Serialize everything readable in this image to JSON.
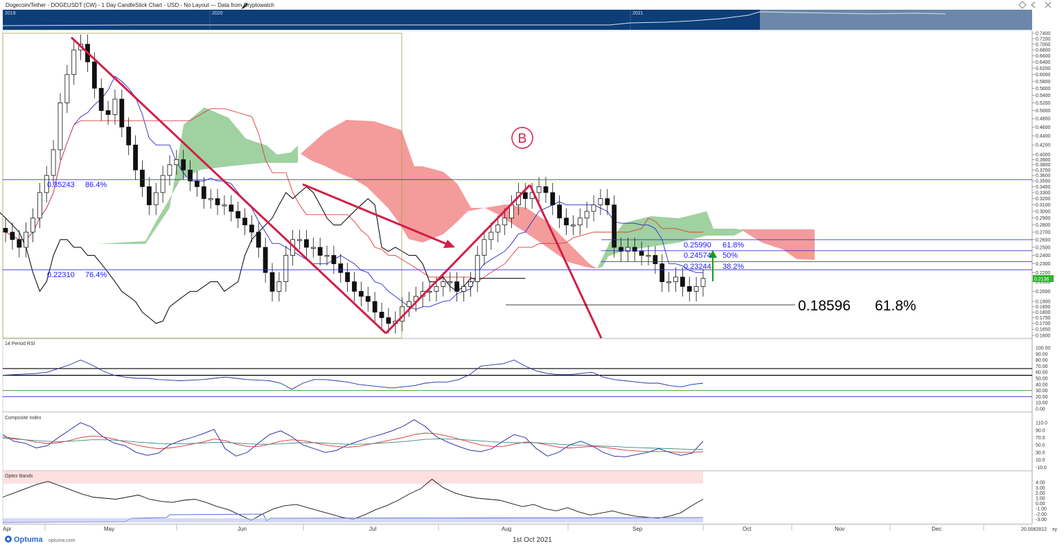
{
  "header": {
    "title": "Dogecoin/Tether - DOGEUSDT (CW) - 1 Day CandleStick Chart - USD - No Layout --- Data from Cryptowatch",
    "icons": [
      "pencil-icon",
      "diamond-icon",
      "chevron-left-icon",
      "close-icon"
    ]
  },
  "navigator": {
    "year_labels": [
      "2019",
      "2020",
      "2021"
    ]
  },
  "footer": {
    "brand": "Optuma",
    "brand_url_text": "optuma.com",
    "date_label": "1st Oct 2021",
    "scale_readout": "20.0082812",
    "xy_label": "xy"
  },
  "annotations": {
    "wave_label": "B",
    "last_price_tag": "0.2136",
    "fib_levels": [
      {
        "value": "0.35243",
        "pct": "86.4%",
        "price": 0.35243
      },
      {
        "value": "0.22310",
        "pct": "76.4%",
        "price": 0.2231
      },
      {
        "value": "0.25990",
        "pct": "61.8%",
        "price": 0.2599
      },
      {
        "value": "0.24574",
        "pct": "50%",
        "price": 0.24574
      },
      {
        "value": "0.23244",
        "pct": "38.2%",
        "price": 0.23244
      }
    ],
    "big_fib": {
      "value": "0.18596",
      "pct": "61.8%",
      "price": 0.18596
    }
  },
  "chart_data": [
    {
      "type": "candlestick",
      "title": "",
      "price_axis": {
        "scale": "log",
        "ticks": [
          "0.7400",
          "0.7200",
          "0.7000",
          "0.6800",
          "0.6600",
          "0.6400",
          "0.6200",
          "0.6000",
          "0.5800",
          "0.5600",
          "0.5400",
          "0.5200",
          "0.5000",
          "0.4800",
          "0.4600",
          "0.4400",
          "0.4200",
          "0.4000",
          "0.3900",
          "0.3800",
          "0.3700",
          "0.3600",
          "0.3500",
          "0.3400",
          "0.3300",
          "0.3200",
          "0.3100",
          "0.3000",
          "0.2900",
          "0.2800",
          "0.2700",
          "0.2600",
          "0.2500",
          "0.2400",
          "0.2300",
          "0.2200",
          "0.2100",
          "0.2000",
          "0.1900",
          "0.1850",
          "0.1800",
          "0.1750",
          "0.1700",
          "0.1650",
          "0.1600"
        ],
        "range": [
          0.155,
          0.75
        ]
      },
      "x_axis_labels": [
        "Apr",
        "May",
        "Jun",
        "Jul",
        "Aug",
        "Sep",
        "Oct",
        "Nov",
        "Dec"
      ],
      "x_label": "1st Oct 2021",
      "series": [
        {
          "name": "DOGEUSDT",
          "kind": "ohlc",
          "close_path": [
            0.27,
            0.26,
            0.25,
            0.27,
            0.29,
            0.33,
            0.36,
            0.41,
            0.52,
            0.6,
            0.68,
            0.7,
            0.64,
            0.56,
            0.5,
            0.49,
            0.53,
            0.46,
            0.42,
            0.37,
            0.34,
            0.31,
            0.33,
            0.36,
            0.38,
            0.39,
            0.37,
            0.35,
            0.34,
            0.32,
            0.32,
            0.31,
            0.31,
            0.3,
            0.29,
            0.28,
            0.27,
            0.25,
            0.22,
            0.2,
            0.21,
            0.24,
            0.26,
            0.26,
            0.25,
            0.25,
            0.24,
            0.24,
            0.23,
            0.22,
            0.21,
            0.2,
            0.195,
            0.19,
            0.18,
            0.175,
            0.17,
            0.172,
            0.185,
            0.19,
            0.195,
            0.2,
            0.2,
            0.205,
            0.21,
            0.21,
            0.2,
            0.205,
            0.21,
            0.24,
            0.26,
            0.27,
            0.28,
            0.29,
            0.31,
            0.33,
            0.32,
            0.33,
            0.34,
            0.33,
            0.31,
            0.29,
            0.28,
            0.28,
            0.29,
            0.3,
            0.31,
            0.32,
            0.31,
            0.25,
            0.245,
            0.25,
            0.245,
            0.24,
            0.24,
            0.23,
            0.21,
            0.21,
            0.215,
            0.205,
            0.2,
            0.205,
            0.2136
          ]
        },
        {
          "name": "",
          "kind": "line",
          "color": "#0000cc"
        },
        {
          "name": "",
          "kind": "line",
          "color": "#e03030"
        },
        {
          "name": "",
          "kind": "line",
          "color": "#000000"
        }
      ]
    },
    {
      "type": "line",
      "title": "14 Period RSI",
      "ticks": [
        "100.00",
        "90.00",
        "80.00",
        "70.00",
        "60.00",
        "50.00",
        "40.00",
        "30.00",
        "20.00",
        "10.00",
        "0.00"
      ],
      "ylim": [
        0,
        100
      ],
      "levels": [
        66,
        55,
        30,
        20
      ],
      "values": [
        55,
        56,
        57,
        58,
        60,
        66,
        72,
        80,
        72,
        62,
        55,
        52,
        50,
        50,
        48,
        47,
        46,
        47,
        48,
        50,
        52,
        50,
        48,
        47,
        46,
        42,
        32,
        42,
        48,
        48,
        46,
        44,
        40,
        38,
        36,
        34,
        36,
        38,
        42,
        44,
        44,
        48,
        56,
        70,
        72,
        74,
        80,
        70,
        62,
        58,
        56,
        56,
        58,
        60,
        52,
        48,
        46,
        44,
        42,
        42,
        38,
        36,
        40,
        42
      ]
    },
    {
      "type": "line",
      "title": "Composite Index",
      "ticks": [
        "110.0",
        "90.0",
        "70.0",
        "50.0",
        "30.0",
        "10.0",
        "-10.0"
      ],
      "ylim": [
        -15,
        125
      ],
      "series": [
        {
          "name": "",
          "color": "#1a1aa0",
          "values": [
            78,
            60,
            55,
            42,
            48,
            70,
            90,
            110,
            98,
            72,
            55,
            48,
            30,
            22,
            28,
            50,
            62,
            70,
            80,
            92,
            40,
            20,
            30,
            55,
            78,
            88,
            72,
            50,
            40,
            30,
            35,
            50,
            60,
            70,
            78,
            88,
            100,
            118,
            100,
            72,
            58,
            46,
            36,
            32,
            40,
            60,
            78,
            70,
            40,
            20,
            30,
            50,
            60,
            48,
            30,
            20,
            18,
            24,
            30,
            40,
            30,
            22,
            28,
            60
          ]
        },
        {
          "name": "",
          "color": "#e03030",
          "values": [
            72,
            68,
            64,
            58,
            54,
            56,
            62,
            70,
            74,
            72,
            66,
            58,
            50,
            44,
            40,
            42,
            46,
            52,
            58,
            66,
            62,
            52,
            46,
            46,
            52,
            60,
            64,
            62,
            56,
            50,
            46,
            44,
            46,
            52,
            58,
            64,
            70,
            78,
            82,
            80,
            74,
            66,
            58,
            50,
            46,
            46,
            52,
            58,
            56,
            50,
            44,
            42,
            44,
            46,
            44,
            40,
            36,
            34,
            32,
            32,
            32,
            30,
            30,
            32
          ]
        },
        {
          "name": "",
          "color": "#3a8a8a",
          "values": [
            68,
            66,
            64,
            62,
            60,
            59,
            60,
            62,
            64,
            64,
            63,
            61,
            58,
            56,
            54,
            53,
            53,
            54,
            55,
            57,
            57,
            55,
            53,
            52,
            52,
            53,
            55,
            56,
            56,
            55,
            53,
            52,
            52,
            53,
            55,
            57,
            59,
            62,
            65,
            66,
            66,
            65,
            63,
            61,
            59,
            57,
            56,
            56,
            56,
            54,
            52,
            50,
            49,
            48,
            47,
            46,
            44,
            43,
            42,
            41,
            40,
            39,
            38,
            38
          ]
        }
      ]
    },
    {
      "type": "line",
      "title": "Optex Bands",
      "ticks": [
        "4.00",
        "3.00",
        "2.00",
        "1.00",
        "0.00",
        "-1.00",
        "-2.00",
        "-3.00"
      ],
      "ylim": [
        -3.6,
        5.6
      ],
      "values": [
        1.2,
        2.0,
        2.8,
        3.6,
        4.2,
        3.4,
        2.6,
        1.8,
        1.2,
        1.0,
        0.8,
        1.2,
        1.6,
        0.8,
        0.4,
        0.2,
        0.6,
        0.8,
        0.2,
        -0.6,
        -1.2,
        -2.2,
        -3.2,
        -2.0,
        -1.0,
        -0.4,
        -0.2,
        -0.8,
        -1.4,
        -2.0,
        -2.6,
        -3.0,
        -2.2,
        -1.2,
        -0.4,
        0.6,
        1.8,
        2.8,
        4.6,
        3.0,
        2.0,
        1.4,
        1.0,
        0.8,
        0.6,
        0.0,
        -0.6,
        -0.2,
        -1.0,
        -1.4,
        -0.8,
        -1.6,
        -2.2,
        -1.8,
        -1.4,
        -2.0,
        -2.4,
        -2.6,
        -2.8,
        -2.4,
        -1.8,
        -0.4,
        0.8
      ]
    }
  ]
}
